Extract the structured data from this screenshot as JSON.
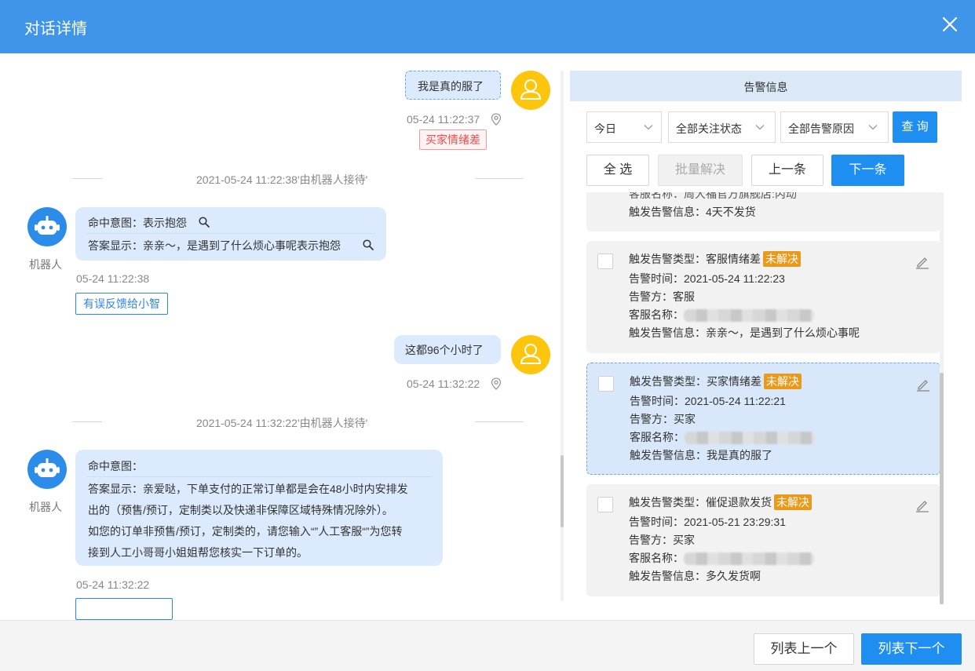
{
  "dialog": {
    "title": "对话详情"
  },
  "chat": {
    "msg1": {
      "text": "我是真的服了",
      "time": "05-24 11:22:37",
      "tag": "买家情绪差"
    },
    "divider1": "2021-05-24 11:22:38'由机器人接待'",
    "robot1": {
      "label": "机器人",
      "intent": "命中意图：表示抱怨",
      "answer": "答案显示：亲亲～，是遇到了什么烦心事呢表示抱怨",
      "time": "05-24 11:22:38",
      "feedback": "有误反馈给小智"
    },
    "msg2": {
      "text": "这都96个小时了",
      "time": "05-24 11:32:22"
    },
    "divider2": "2021-05-24 11:32:22'由机器人接待'",
    "robot2": {
      "label": "机器人",
      "intent": "命中意图：",
      "answer_lines": [
        "答案显示：亲爱哒，下单支付的正常订单都是会在48小时内安排发",
        "出的（预售/预订，定制类以及快递非保障区域特殊情况除外）。",
        "如您的订单非预售/预订，定制类的，请您输入“”人工客服“”为您转",
        "接到人工小哥哥小姐姐帮您核实一下订单的。"
      ],
      "time": "05-24 11:32:22"
    }
  },
  "alerts": {
    "header": "告警信息",
    "filters": {
      "date": "今日",
      "focus": "全部关注状态",
      "reason": "全部告警原因"
    },
    "buttons": {
      "query": "查 询",
      "select_all": "全 选",
      "batch": "批量解决",
      "prev": "上一条",
      "next": "下一条"
    },
    "partial": {
      "service_name": "客服名称：周大福官方旗舰店:丙动",
      "info": "触发告警信息：4天不发货"
    },
    "cards": [
      {
        "type": "触发告警类型：客服情绪差",
        "status": "未解决",
        "time": "告警时间：2021-05-24 11:22:23",
        "party": "告警方：客服",
        "service_label": "客服名称：",
        "info": "触发告警信息：亲亲～，是遇到了什么烦心事呢"
      },
      {
        "type": "触发告警类型：买家情绪差",
        "status": "未解决",
        "time": "告警时间：2021-05-24 11:22:21",
        "party": "告警方：买家",
        "service_label": "客服名称：",
        "info": "触发告警信息：我是真的服了"
      },
      {
        "type": "触发告警类型：催促退款发货",
        "status": "未解决",
        "time": "告警时间：2021-05-21 23:29:31",
        "party": "告警方：买家",
        "service_label": "客服名称：",
        "info": "触发告警信息：多久发货啊"
      }
    ]
  },
  "footer": {
    "prev": "列表上一个",
    "next": "列表下一个"
  },
  "colors": {
    "header": "#3e95ea",
    "primary": "#1f8ef1",
    "bubble": "#dbeafc",
    "badge": "#e99a1b",
    "user_avatar": "#fdc60c",
    "robot_avatar": "#2b8de9"
  },
  "icons": [
    "close-icon",
    "user-avatar-icon",
    "robot-avatar-icon",
    "location-pin-icon",
    "search-icon",
    "chevron-down-icon",
    "edit-icon"
  ]
}
